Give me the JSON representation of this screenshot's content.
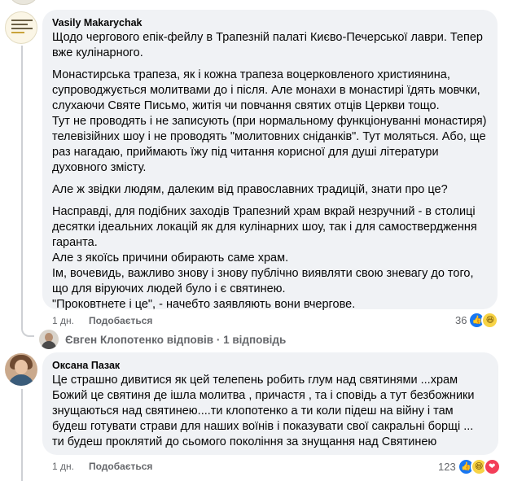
{
  "comments": [
    {
      "author": "Vasily Makarychak",
      "paragraphs": [
        "Щодо чергового епік-фейлу в Трапезній палаті Києво-Печерської лаври. Тепер вже кулінарного.",
        "Монастирська трапеза, як і кожна трапеза воцерковленого християнина, супроводжується молитвами до і після. Але монахи в монастирі їдять мовчки, слухаючи Святе Письмо, житія чи повчання святих отців Церкви тощо.\nТут не проводять і не записують (при нормальному функціонуванні монастиря) телевізійних шоу і не проводять \"молитовних сніданків\". Тут моляться. Або, ще раз нагадаю, приймають їжу під читання корисної для душі літератури духовного змісту.",
        "Але ж звідки людям, далеким від православних традицій, знати про це?",
        "Насправді, для подібних заходів Трапезний храм вкрай незручний - в столиці десятки ідеальних локацій як для кулінарних шоу, так і для самоствердження гаранта.\nАле з якоїсь причини обирають саме храм.\nІм, вочевидь, важливо знову і знову публічно виявляти свою зневагу до того, що для віруючих людей було і є святинею.\n\"Проковтнете і це\", - начебто заявляють вони вчергове."
      ],
      "time": "1 дн.",
      "like_label": "Подобається",
      "reply_label": "Відповісти",
      "reaction_count": "36",
      "reactions": [
        "like",
        "haha"
      ]
    },
    {
      "author": "Оксана Пазак",
      "paragraphs": [
        "Це страшно дивитися як цей телепень робить глум над святинями ...храм Божий це святиня де ішла молитва , причастя , та і сповідь а тут безбожники знущаються над святинею....ти клопотенко а ти коли підеш на війну і там будеш готувати страви для наших воїнів і показувати свої сакральні борщі ... ти будеш проклятий до сьомого покоління за знущання над Святинею"
      ],
      "time": "1 дн.",
      "like_label": "Подобається",
      "reply_label": "Відповісти",
      "reaction_count": "123",
      "reactions": [
        "like",
        "haha",
        "love"
      ]
    }
  ],
  "reply_thread": {
    "text": "Євген Клопотенко відповів · 1 відповідь"
  },
  "colors": {
    "bubble": "#f0f2f5",
    "meta_text": "#65676b",
    "like_blue": "#1877f2",
    "love_red": "#f33e58",
    "haha_yellow": "#f7d346"
  }
}
